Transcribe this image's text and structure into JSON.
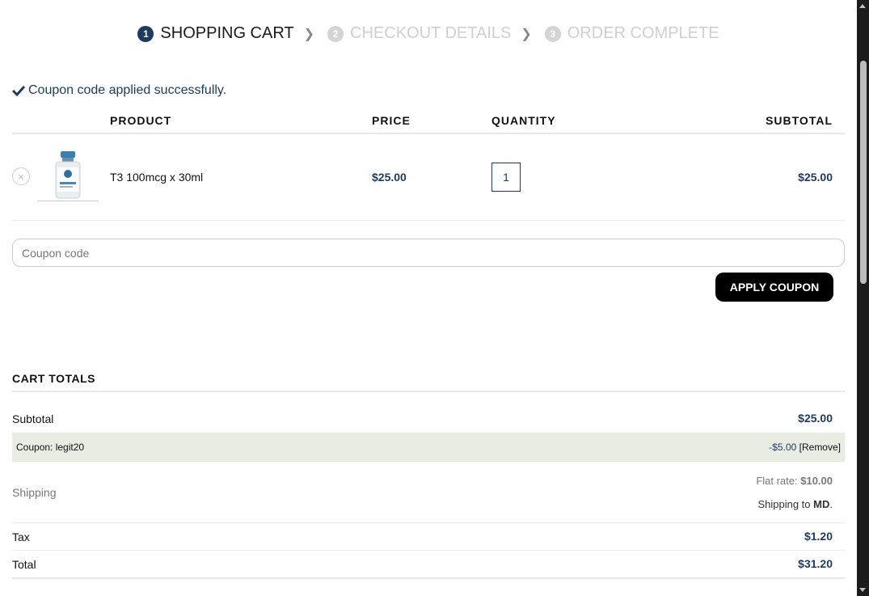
{
  "steps": [
    {
      "num": "1",
      "label": "SHOPPING CART"
    },
    {
      "num": "2",
      "label": "CHECKOUT DETAILS"
    },
    {
      "num": "3",
      "label": "ORDER COMPLETE"
    }
  ],
  "notice": {
    "text": "Coupon code applied successfully.",
    "color": "#1e3a5f"
  },
  "table": {
    "headers": {
      "product": "PRODUCT",
      "price": "PRICE",
      "quantity": "QUANTITY",
      "subtotal": "SUBTOTAL"
    },
    "item": {
      "remove": "×",
      "name": "T3 100mcg x 30ml",
      "price": "$25.00",
      "quantity": "1",
      "subtotal": "$25.00"
    }
  },
  "coupon": {
    "placeholder": "Coupon code",
    "button": "APPLY COUPON"
  },
  "totals": {
    "title": "CART TOTALS",
    "subtotal_label": "Subtotal",
    "subtotal_value": "$25.00",
    "coupon_label": "Coupon: legit20",
    "coupon_value": "-$5.00",
    "coupon_remove": "[Remove]",
    "shipping_label": "Shipping",
    "shipping_rate_label": "Flat rate:",
    "shipping_rate_value": "$10.00",
    "shipping_to_prefix": "Shipping to",
    "shipping_to_state": "MD",
    "shipping_to_suffix": ".",
    "tax_label": "Tax",
    "tax_value": "$1.20",
    "total_label": "Total",
    "total_value": "$31.20"
  },
  "colors": {
    "accent": "#1e3a5f",
    "coupon_row_bg": "#e8ece3"
  }
}
